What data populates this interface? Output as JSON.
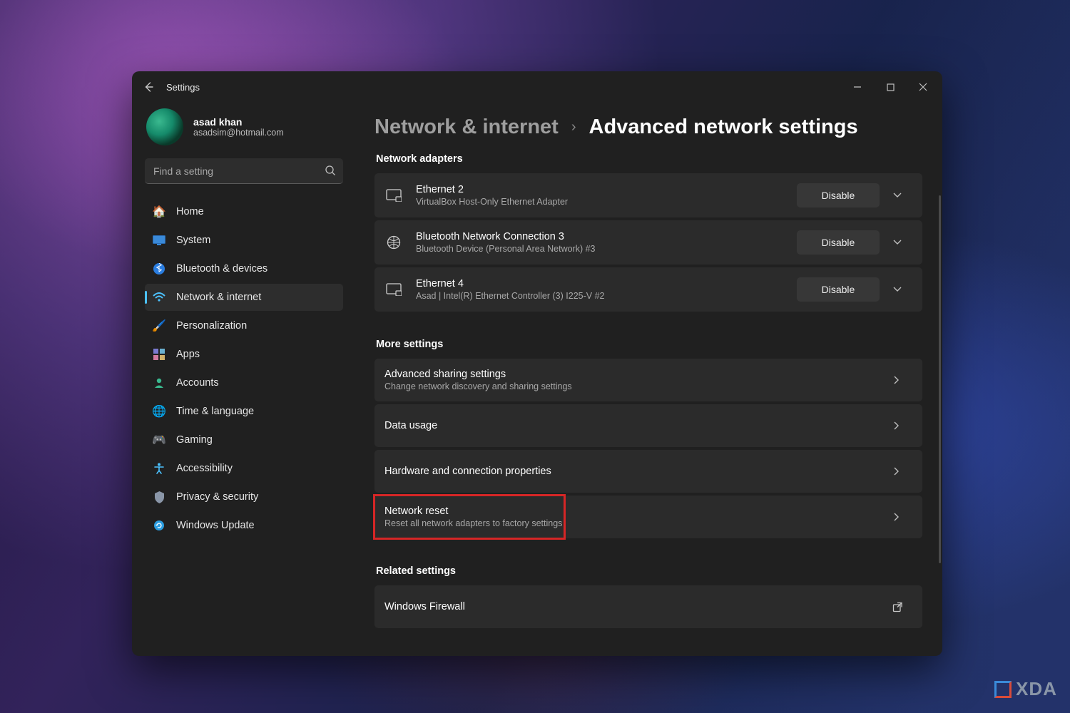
{
  "window": {
    "title": "Settings"
  },
  "user": {
    "name": "asad khan",
    "email": "asadsim@hotmail.com"
  },
  "search": {
    "placeholder": "Find a setting"
  },
  "sidebar": {
    "items": [
      {
        "label": "Home"
      },
      {
        "label": "System"
      },
      {
        "label": "Bluetooth & devices"
      },
      {
        "label": "Network & internet"
      },
      {
        "label": "Personalization"
      },
      {
        "label": "Apps"
      },
      {
        "label": "Accounts"
      },
      {
        "label": "Time & language"
      },
      {
        "label": "Gaming"
      },
      {
        "label": "Accessibility"
      },
      {
        "label": "Privacy & security"
      },
      {
        "label": "Windows Update"
      }
    ]
  },
  "breadcrumb": {
    "parent": "Network & internet",
    "current": "Advanced network settings"
  },
  "sections": {
    "adapters_title": "Network adapters",
    "more_title": "More settings",
    "related_title": "Related settings"
  },
  "adapters": [
    {
      "title": "Ethernet 2",
      "sub": "VirtualBox Host-Only Ethernet Adapter",
      "action": "Disable"
    },
    {
      "title": "Bluetooth Network Connection 3",
      "sub": "Bluetooth Device (Personal Area Network) #3",
      "action": "Disable"
    },
    {
      "title": "Ethernet 4",
      "sub": "Asad | Intel(R) Ethernet Controller (3) I225-V #2",
      "action": "Disable"
    }
  ],
  "more": [
    {
      "title": "Advanced sharing settings",
      "sub": "Change network discovery and sharing settings"
    },
    {
      "title": "Data usage",
      "sub": ""
    },
    {
      "title": "Hardware and connection properties",
      "sub": ""
    },
    {
      "title": "Network reset",
      "sub": "Reset all network adapters to factory settings"
    }
  ],
  "related": [
    {
      "title": "Windows Firewall"
    }
  ],
  "watermark": "XDA"
}
